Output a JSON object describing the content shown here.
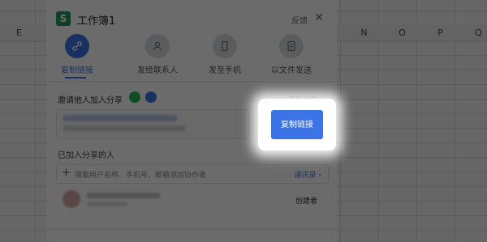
{
  "spreadsheet": {
    "columns": [
      "E",
      "N",
      "O",
      "P",
      "Q"
    ]
  },
  "dialog": {
    "title": "工作簿1",
    "feedback": "反馈",
    "close_icon": "close-icon",
    "share_options": [
      {
        "label": "复制链接",
        "icon": "link-icon",
        "active": true
      },
      {
        "label": "发给联系人",
        "icon": "person-icon",
        "active": false
      },
      {
        "label": "发至手机",
        "icon": "phone-icon",
        "active": false
      },
      {
        "label": "以文件发送",
        "icon": "file-icon",
        "active": false
      }
    ],
    "invite_label": "邀请他人加入分享",
    "advanced_settings": "高级设置 ›",
    "copy_button": "复制链接",
    "joined_label": "已加入分享的人",
    "search_placeholder": "搜索用户名称、手机号、邮箱添加协作者",
    "contacts_link": "通讯录 ›",
    "member_role": "创建者"
  },
  "colors": {
    "accent": "#3b74e6",
    "wechat": "#1fb94f",
    "logo": "#1e9b58"
  }
}
